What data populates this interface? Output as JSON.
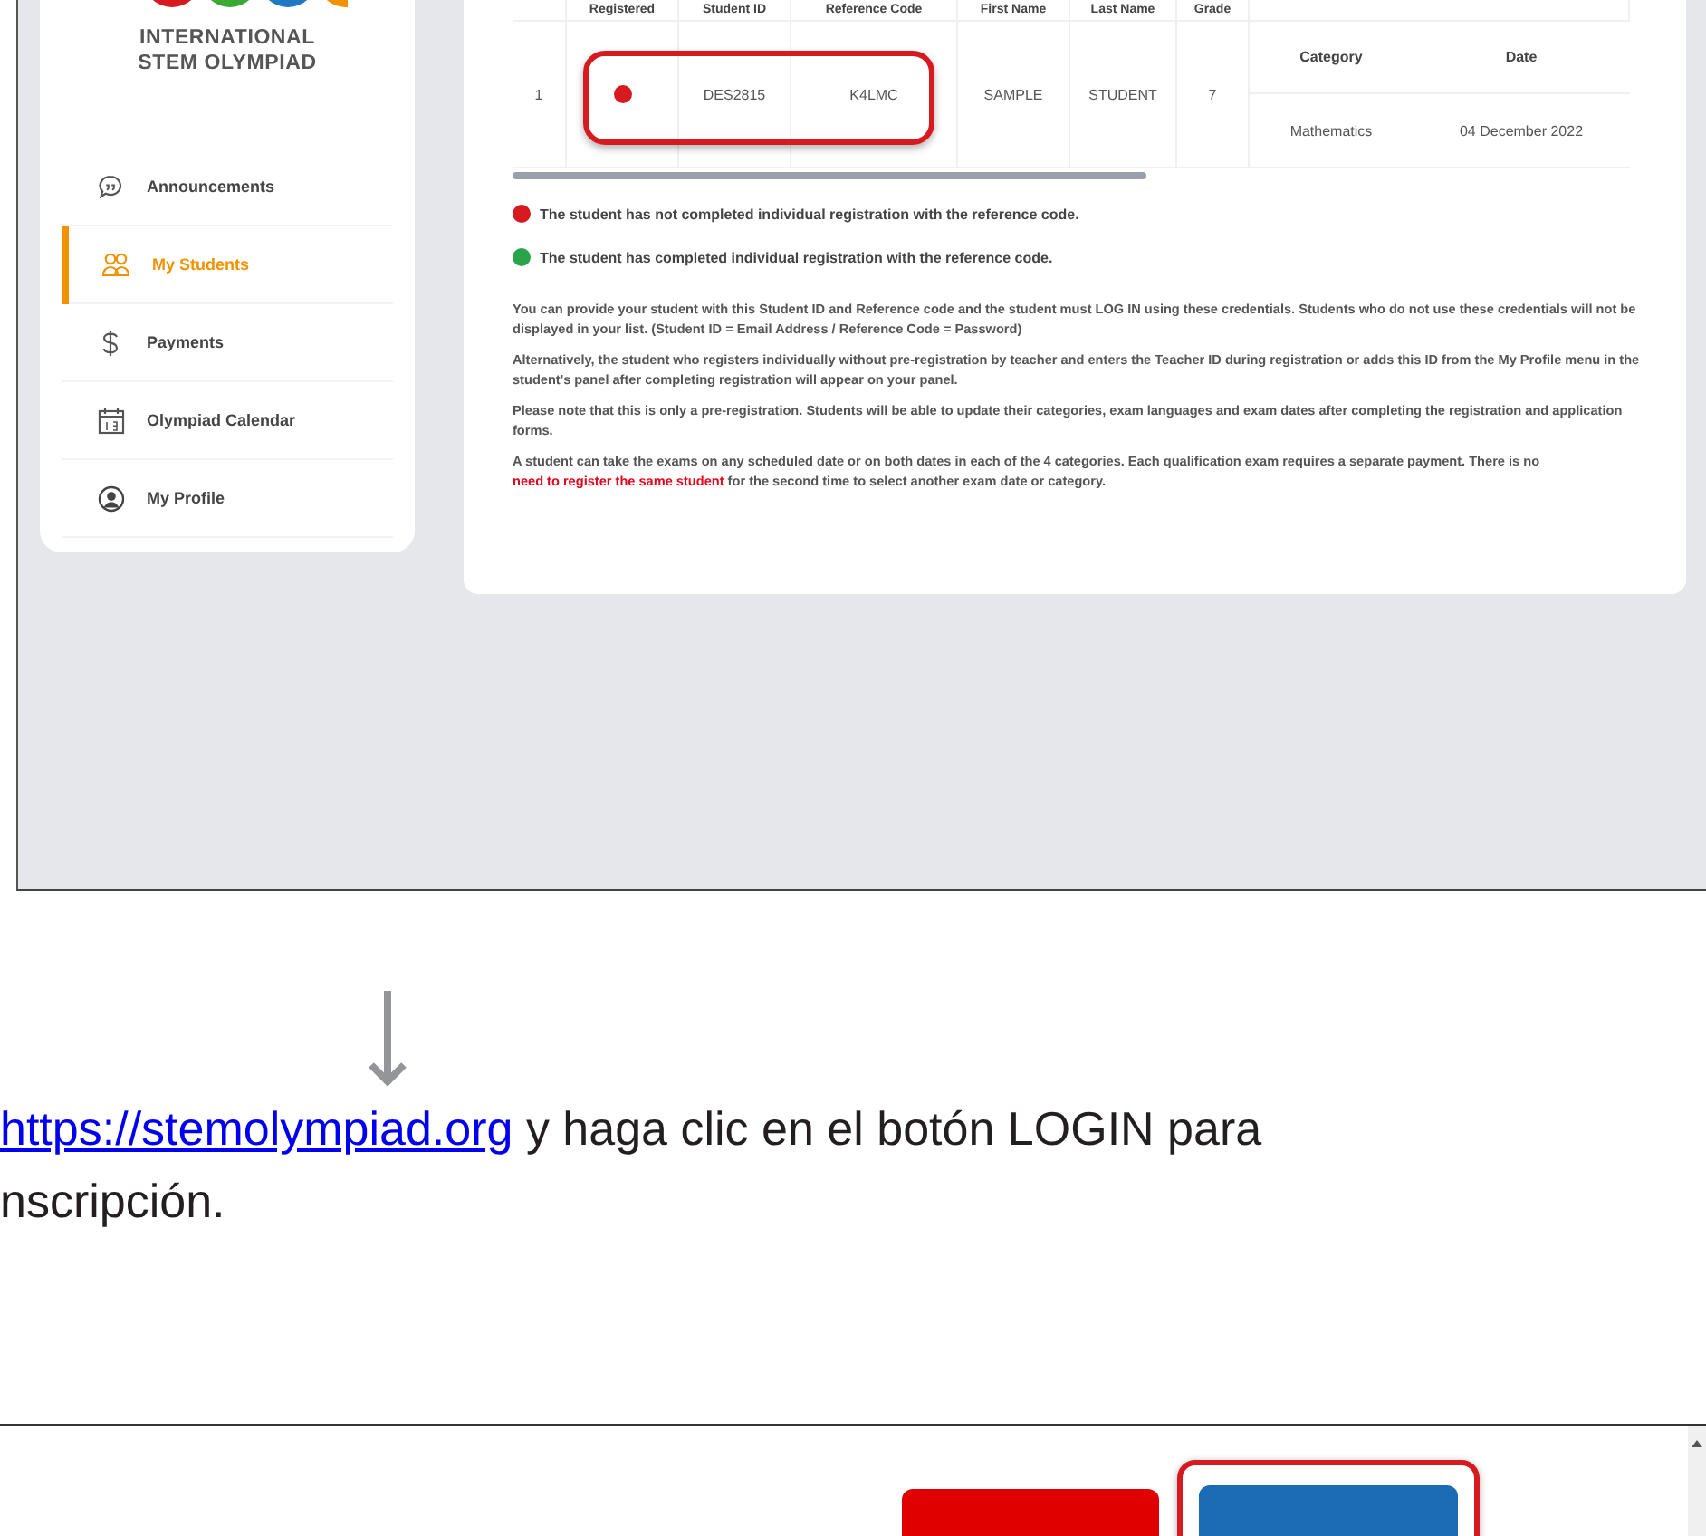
{
  "sidebar": {
    "logo_lines": [
      "INTERNATIONAL",
      "STEM OLYMPIAD"
    ],
    "items": [
      {
        "kind": "announcements",
        "label": "Announcements",
        "selected": false
      },
      {
        "kind": "students",
        "label": "My Students",
        "selected": true
      },
      {
        "kind": "payments",
        "label": "Payments",
        "selected": false
      },
      {
        "kind": "calendar",
        "label": "Olympiad Calendar",
        "selected": false
      },
      {
        "kind": "profile",
        "label": "My Profile",
        "selected": false
      }
    ]
  },
  "students_table": {
    "columns": [
      "Registered",
      "Student ID",
      "Reference Code",
      "First Name",
      "Last Name",
      "Grade"
    ],
    "rows": [
      {
        "number": "1",
        "registered": false,
        "highlighted": true,
        "student_id": "DES2815",
        "reference_code": "K4LMC",
        "first_name": "SAMPLE",
        "last_name": "STUDENT",
        "grade": "7",
        "exams": {
          "columns": [
            "Category",
            "Date"
          ],
          "rows": [
            {
              "category": "Mathematics",
              "date": "04 December 2022"
            }
          ]
        }
      }
    ]
  },
  "legend": [
    {
      "color": "#d71920",
      "text": "The student has not completed individual registration with the reference code."
    },
    {
      "color": "#2aa34a",
      "text": "The student has completed individual registration with the reference code."
    }
  ],
  "notes": [
    {
      "parts": [
        {
          "kind": "text",
          "text": "You can provide your student with this Student ID and Reference code and the student must LOG IN using these credentials. Students who do not use these credentials will not be displayed in your list. (Student ID = Email Address / Reference Code = Password)"
        }
      ]
    },
    {
      "parts": [
        {
          "kind": "text",
          "text": "Alternatively, the student who registers individually without pre-registration by teacher and enters the Teacher ID during registration or adds this ID from the My Profile menu in the student's panel after completing registration will appear on your panel."
        }
      ]
    },
    {
      "parts": [
        {
          "kind": "text",
          "text": "Please note that this is only a pre-registration. Students will be able to update their categories, exam languages and exam dates after completing the registration and application forms."
        }
      ]
    },
    {
      "parts": [
        {
          "kind": "text",
          "text": "A student can take the exams on any scheduled date or on both dates in each of the 4 categories. Each qualification exam requires a separate payment. There is no "
        },
        {
          "kind": "link",
          "text": "need to register the same student"
        },
        {
          "kind": "text",
          "text": " for the second time to select another exam date or category."
        }
      ]
    }
  ],
  "instruction": {
    "link": "https://stemolympiad.org",
    "text": "y haga clic en el botón LOGIN para",
    "text_line_2": "nscripción."
  },
  "login_screenshot": {
    "buttons": [
      {
        "kind": "plain",
        "highlighted": false
      },
      {
        "kind": "login",
        "highlighted": true
      }
    ]
  }
}
